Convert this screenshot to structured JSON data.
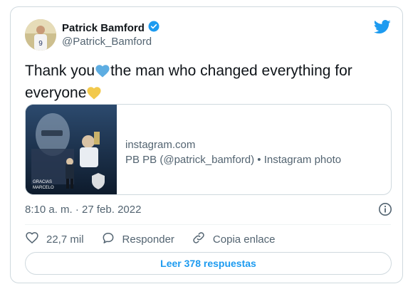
{
  "author": {
    "name": "Patrick Bamford",
    "handle": "@Patrick_Bamford",
    "avatar_jersey_number": "9"
  },
  "tweet": {
    "text_part1": "Thank you",
    "text_part2": "the man who changed everything for everyone"
  },
  "link_card": {
    "domain": "instagram.com",
    "title": "PB PB (@patrick_bamford) • Instagram photo",
    "image_caption_line1": "GRACIAS",
    "image_caption_line2": "MARCELO"
  },
  "meta": {
    "timestamp": "8:10 a. m. · 27 feb. 2022"
  },
  "actions": {
    "likes": "22,7 mil",
    "reply_label": "Responder",
    "copy_link_label": "Copia enlace"
  },
  "replies_button": {
    "label": "Leer 378 respuestas"
  },
  "colors": {
    "twitter_blue": "#1d9bf0",
    "blue_heart": "#5dade2",
    "yellow_heart": "#f2c94c",
    "verified": "#1d9bf0"
  }
}
